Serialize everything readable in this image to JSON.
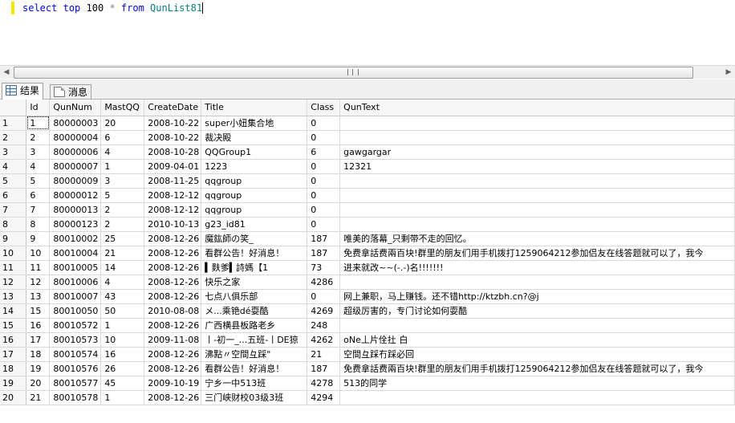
{
  "editor": {
    "sql_select": "select",
    "sql_top": "top",
    "sql_limit": "100",
    "sql_star": "*",
    "sql_from": "from",
    "sql_table": "QunList81"
  },
  "tabs": [
    {
      "label": "结果",
      "icon": "grid-icon",
      "active": true
    },
    {
      "label": "消息",
      "icon": "message-icon",
      "active": false
    }
  ],
  "columns": [
    "Id",
    "QunNum",
    "MastQQ",
    "CreateDate",
    "Title",
    "Class",
    "QunText"
  ],
  "rows": [
    {
      "rn": "1",
      "id": "1",
      "qunnum": "80000003",
      "mastqq": "20",
      "date": "2008-10-22",
      "title": "super小妞集合地",
      "class": "0",
      "text": ""
    },
    {
      "rn": "2",
      "id": "2",
      "qunnum": "80000004",
      "mastqq": "6",
      "date": "2008-10-22",
      "title": "裁决殿",
      "class": "0",
      "text": ""
    },
    {
      "rn": "3",
      "id": "3",
      "qunnum": "80000006",
      "mastqq": "4",
      "date": "2008-10-28",
      "title": "QQGroup1",
      "class": "6",
      "text": "gawgargar"
    },
    {
      "rn": "4",
      "id": "4",
      "qunnum": "80000007",
      "mastqq": "1",
      "date": "2009-04-01",
      "title": "1223",
      "class": "0",
      "text": "12321"
    },
    {
      "rn": "5",
      "id": "5",
      "qunnum": "80000009",
      "mastqq": "3",
      "date": "2008-11-25",
      "title": "qqgroup",
      "class": "0",
      "text": ""
    },
    {
      "rn": "6",
      "id": "6",
      "qunnum": "80000012",
      "mastqq": "5",
      "date": "2008-12-12",
      "title": "qqgroup",
      "class": "0",
      "text": ""
    },
    {
      "rn": "7",
      "id": "7",
      "qunnum": "80000013",
      "mastqq": "2",
      "date": "2008-12-12",
      "title": "qqgroup",
      "class": "0",
      "text": ""
    },
    {
      "rn": "8",
      "id": "8",
      "qunnum": "80000123",
      "mastqq": "2",
      "date": "2010-10-13",
      "title": "g23_id81",
      "class": "0",
      "text": ""
    },
    {
      "rn": "9",
      "id": "9",
      "qunnum": "80010002",
      "mastqq": "25",
      "date": "2008-12-26",
      "title": "魔鈜師の笑_",
      "class": "187",
      "text": "唯美的落幕_只剩带不走的回忆。"
    },
    {
      "rn": "10",
      "id": "10",
      "qunnum": "80010004",
      "mastqq": "21",
      "date": "2008-12-26",
      "title": "看群公告！好消息！",
      "class": "187",
      "text": "免费拿話费兩百块!群里的朋友们用手机拨打1259064212参加侣友在线答题就可以了，我今"
    },
    {
      "rn": "11",
      "id": "11",
      "qunnum": "80010005",
      "mastqq": "14",
      "date": "2008-12-26",
      "title": "▍麩爹▍詩媽【1",
      "class": "73",
      "text": "进来就改~~(-.-)名!!!!!!!"
    },
    {
      "rn": "12",
      "id": "12",
      "qunnum": "80010006",
      "mastqq": "4",
      "date": "2008-12-26",
      "title": "快乐之家",
      "class": "4286",
      "text": ""
    },
    {
      "rn": "13",
      "id": "13",
      "qunnum": "80010007",
      "mastqq": "43",
      "date": "2008-12-26",
      "title": "七点八俱乐部",
      "class": "0",
      "text": "网上兼职，马上赚钱。还不错http://ktzbh.cn?@j"
    },
    {
      "rn": "14",
      "id": "15",
      "qunnum": "80010050",
      "mastqq": "50",
      "date": "2010-08-08",
      "title": "メ...乘铯dé耍酷",
      "class": "4269",
      "text": "超级厉害的，专门讨论如何耍酷"
    },
    {
      "rn": "15",
      "id": "16",
      "qunnum": "80010572",
      "mastqq": "1",
      "date": "2008-12-26",
      "title": "广西横县板路老乡",
      "class": "248",
      "text": ""
    },
    {
      "rn": "16",
      "id": "17",
      "qunnum": "80010573",
      "mastqq": "10",
      "date": "2009-11-08",
      "title": "丨-初一_...五班-丨DE猄",
      "class": "4262",
      "text": "oNe丄片佺扗 白"
    },
    {
      "rn": "17",
      "id": "18",
      "qunnum": "80010574",
      "mastqq": "16",
      "date": "2008-12-26",
      "title": "沸點〃空間彑踩\"",
      "class": "21",
      "text": "空間彑踩冇踩必回"
    },
    {
      "rn": "18",
      "id": "19",
      "qunnum": "80010576",
      "mastqq": "26",
      "date": "2008-12-26",
      "title": "看群公告！好消息！",
      "class": "187",
      "text": "免费拿話费兩百块!群里的朋友们用手机拨打1259064212参加侣友在线答题就可以了，我今"
    },
    {
      "rn": "19",
      "id": "20",
      "qunnum": "80010577",
      "mastqq": "45",
      "date": "2009-10-19",
      "title": "宁乡一中513班",
      "class": "4278",
      "text": "513的同学"
    },
    {
      "rn": "20",
      "id": "21",
      "qunnum": "80010578",
      "mastqq": "1",
      "date": "2008-12-26",
      "title": "三门峡财校03级3班",
      "class": "4294",
      "text": ""
    }
  ]
}
